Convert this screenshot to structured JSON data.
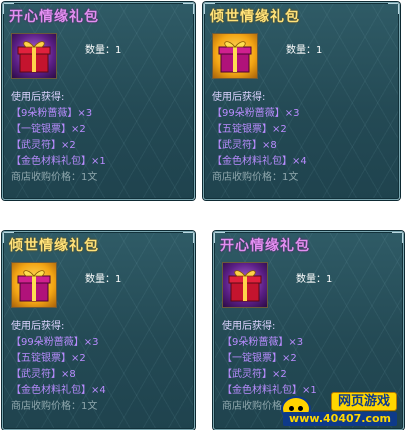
{
  "cards": [
    {
      "title": "开心情缘礼包",
      "quantity_label": "数量：",
      "quantity_value": "1",
      "use_label": "使用后获得:",
      "items": [
        {
          "name": "【9朵粉蔷薇】",
          "mul": "×3"
        },
        {
          "name": "【一锭银票】",
          "mul": "×2"
        },
        {
          "name": "【武灵符】",
          "mul": "×2"
        },
        {
          "name": "【金色材料礼包】",
          "mul": "×1"
        }
      ],
      "price": "商店收购价格：1文"
    },
    {
      "title": "倾世情缘礼包",
      "quantity_label": "数量：",
      "quantity_value": "1",
      "use_label": "使用后获得:",
      "items": [
        {
          "name": "【99朵粉蔷薇】",
          "mul": "×3"
        },
        {
          "name": "【五锭银票】",
          "mul": "×2"
        },
        {
          "name": "【武灵符】",
          "mul": "×8"
        },
        {
          "name": "【金色材料礼包】",
          "mul": "×4"
        }
      ],
      "price": "商店收购价格：1文"
    },
    {
      "title": "倾世情缘礼包",
      "quantity_label": "数量：",
      "quantity_value": "1",
      "use_label": "使用后获得:",
      "items": [
        {
          "name": "【99朵粉蔷薇】",
          "mul": "×3"
        },
        {
          "name": "【五锭银票】",
          "mul": "×2"
        },
        {
          "name": "【武灵符】",
          "mul": "×8"
        },
        {
          "name": "【金色材料礼包】",
          "mul": "×4"
        }
      ],
      "price": "商店收购价格：1文"
    },
    {
      "title": "开心情缘礼包",
      "quantity_label": "数量：",
      "quantity_value": "1",
      "use_label": "使用后获得:",
      "items": [
        {
          "name": "【9朵粉蔷薇】",
          "mul": "×3"
        },
        {
          "name": "【一锭银票】",
          "mul": "×2"
        },
        {
          "name": "【武灵符】",
          "mul": "×2"
        },
        {
          "name": "【金色材料礼包】",
          "mul": "×1"
        }
      ],
      "price": "商店收购价格：1文"
    }
  ],
  "watermark": {
    "top": "网页游戏",
    "bottom": "www.40407.com"
  },
  "colors": {
    "title_purple": "#e28ff0",
    "title_yellow": "#ffe27a",
    "item": "#b98cff",
    "panel": "#2f5b66"
  }
}
